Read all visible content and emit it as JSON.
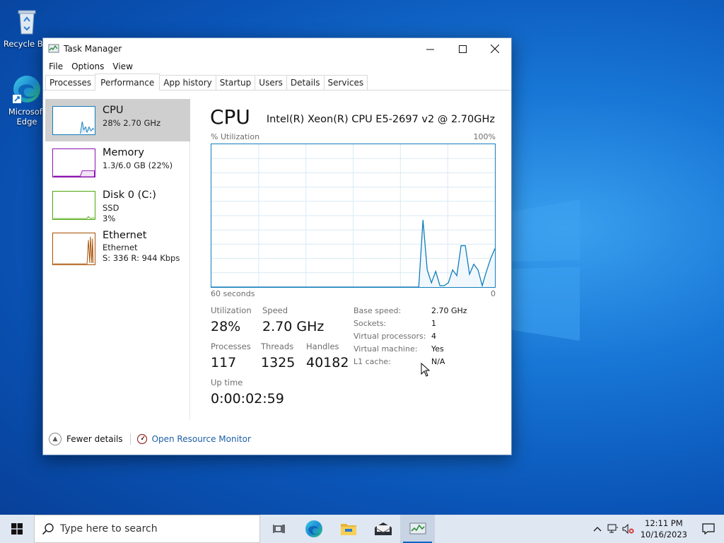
{
  "desktop": {
    "icons": [
      {
        "label": "Recycle Bin"
      },
      {
        "label": "Microsoft Edge"
      }
    ]
  },
  "window": {
    "title": "Task Manager",
    "controls": {
      "minimize": "—",
      "maximize": "☐",
      "close": "✕"
    },
    "menu": [
      "File",
      "Options",
      "View"
    ],
    "tabs": [
      "Processes",
      "Performance",
      "App history",
      "Startup",
      "Users",
      "Details",
      "Services"
    ],
    "active_tab": "Performance"
  },
  "sidebar": {
    "items": [
      {
        "name": "CPU",
        "line1": "28% 2.70 GHz",
        "line2": "",
        "color": "#117dbb",
        "selected": true
      },
      {
        "name": "Memory",
        "line1": "1.3/6.0 GB (22%)",
        "line2": "",
        "color": "#8b12ae",
        "selected": false
      },
      {
        "name": "Disk 0 (C:)",
        "line1": "SSD",
        "line2": "3%",
        "color": "#4da60c",
        "selected": false
      },
      {
        "name": "Ethernet",
        "line1": "Ethernet",
        "line2": "S: 336 R: 944 Kbps",
        "color": "#a74f01",
        "selected": false
      }
    ]
  },
  "cpu": {
    "title": "CPU",
    "model": "Intel(R) Xeon(R) CPU E5-2697 v2 @ 2.70GHz",
    "graph_y_label": "% Utilization",
    "graph_y_max": "100%",
    "graph_x_left": "60 seconds",
    "graph_x_right": "0",
    "utilization_label": "Utilization",
    "utilization": "28%",
    "speed_label": "Speed",
    "speed": "2.70 GHz",
    "processes_label": "Processes",
    "processes": "117",
    "threads_label": "Threads",
    "threads": "1325",
    "handles_label": "Handles",
    "handles": "40182",
    "uptime_label": "Up time",
    "uptime": "0:00:02:59",
    "details": [
      {
        "key": "Base speed:",
        "value": "2.70 GHz"
      },
      {
        "key": "Sockets:",
        "value": "1"
      },
      {
        "key": "Virtual processors:",
        "value": "4"
      },
      {
        "key": "Virtual machine:",
        "value": "Yes"
      },
      {
        "key": "L1 cache:",
        "value": "N/A"
      }
    ],
    "history": [
      0,
      0,
      0,
      0,
      0,
      0,
      0,
      0,
      0,
      0,
      0,
      0,
      0,
      0,
      0,
      0,
      0,
      0,
      0,
      0,
      0,
      0,
      0,
      0,
      0,
      0,
      0,
      0,
      0,
      0,
      0,
      0,
      0,
      0,
      0,
      0,
      0,
      0,
      0,
      0,
      0,
      0,
      0,
      0,
      0,
      0,
      0,
      0,
      0,
      0,
      47,
      12,
      3,
      11,
      1,
      1,
      3,
      12,
      8,
      29,
      29,
      9,
      16,
      12,
      1,
      11,
      20,
      27
    ]
  },
  "footer": {
    "fewer_details": "Fewer details",
    "open_resource_monitor": "Open Resource Monitor"
  },
  "taskbar": {
    "search_placeholder": "Type here to search",
    "clock_time": "12:11 PM",
    "clock_date": "10/16/2023",
    "pinned": [
      "task-view",
      "edge",
      "file-explorer",
      "mail",
      "task-manager"
    ]
  },
  "colors": {
    "cpu": "#117dbb",
    "memory": "#8b12ae",
    "disk": "#4da60c",
    "ethernet": "#a74f01",
    "link": "#1c5fa8"
  }
}
